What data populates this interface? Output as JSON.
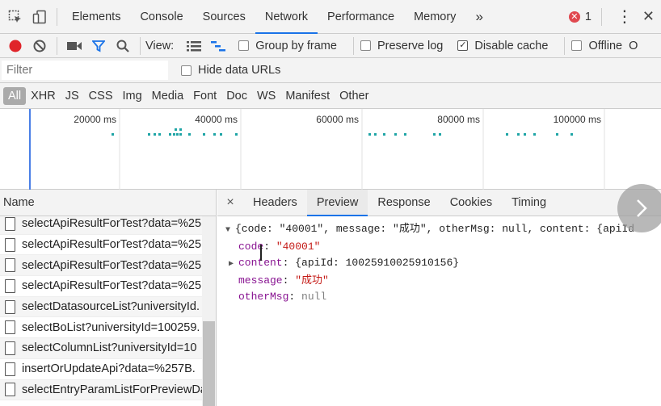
{
  "tabs": {
    "items": [
      "Elements",
      "Console",
      "Sources",
      "Network",
      "Performance",
      "Memory"
    ],
    "active": "Network",
    "more_glyph": "»",
    "error_count": "1",
    "error_glyph": "✕",
    "menu_glyph": "⋮",
    "close_glyph": "✕"
  },
  "toolbar": {
    "view_label": "View:",
    "group_by_frame": "Group by frame",
    "preserve_log": "Preserve log",
    "disable_cache": "Disable cache",
    "offline": "Offline",
    "cut_label": "O"
  },
  "filter": {
    "placeholder": "Filter",
    "hide_data_urls": "Hide data URLs"
  },
  "types": [
    "All",
    "XHR",
    "JS",
    "CSS",
    "Img",
    "Media",
    "Font",
    "Doc",
    "WS",
    "Manifest",
    "Other"
  ],
  "timeline": {
    "ticks": [
      "20000 ms",
      "40000 ms",
      "60000 ms",
      "80000 ms",
      "100000 ms"
    ],
    "bar_color": "#1fa5a6",
    "marker_color": "#4a7fe6"
  },
  "requests": {
    "header": "Name",
    "items": [
      "selectApiResultForTest?data=%25",
      "selectApiResultForTest?data=%25",
      "selectApiResultForTest?data=%25",
      "selectApiResultForTest?data=%25",
      "selectDatasourceList?universityId.",
      "selectBoList?universityId=100259.",
      "selectColumnList?universityId=10",
      "insertOrUpdateApi?data=%257B.",
      "selectEntryParamListForPreviewDa"
    ]
  },
  "details": {
    "close_glyph": "×",
    "tabs": [
      "Headers",
      "Preview",
      "Response",
      "Cookies",
      "Timing"
    ],
    "active": "Preview",
    "summary": "{code: \"40001\", message: \"成功\", otherMsg: null, content: {apiId",
    "fields": {
      "code_key": "code",
      "code_val": "\"40001\"",
      "content_key": "content",
      "content_val": "{apiId: 10025910025910156}",
      "message_key": "message",
      "message_val": "\"成功\"",
      "othermsg_key": "otherMsg",
      "othermsg_val": "null"
    }
  },
  "colors": {
    "accent": "#1a73e8",
    "record": "#e0242a",
    "filter_icon": "#1a73e8",
    "key": "#881391",
    "string": "#c41a16"
  }
}
